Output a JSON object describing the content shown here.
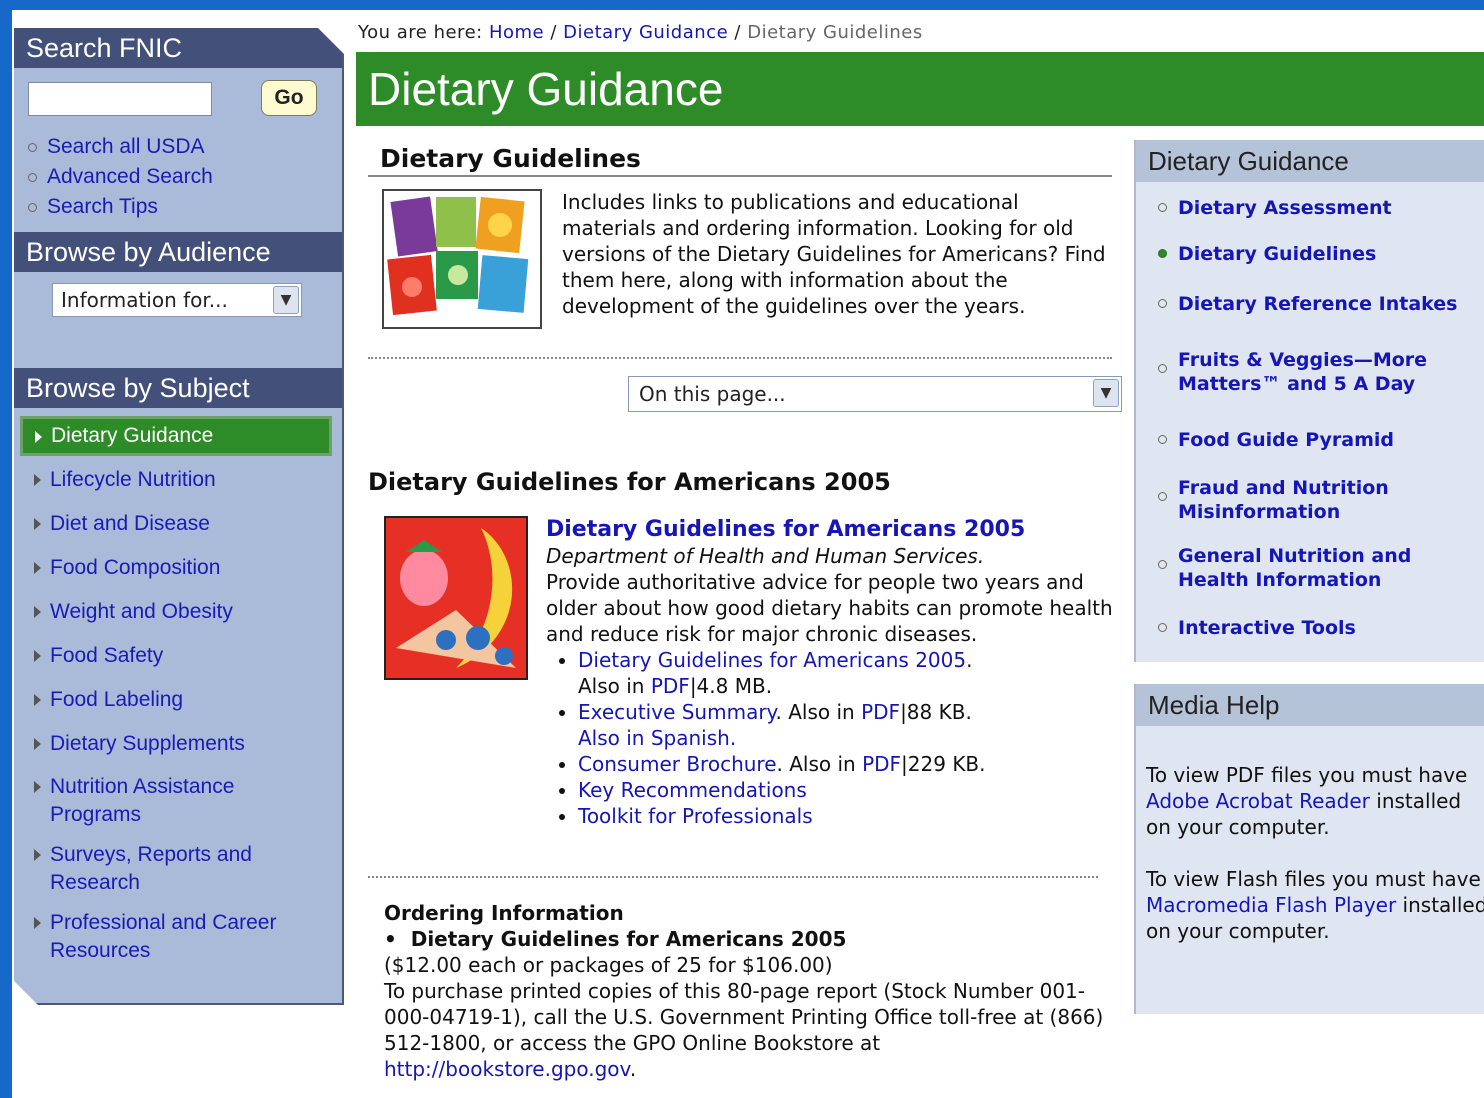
{
  "search": {
    "heading": "Search FNIC",
    "input_value": "",
    "go_label": "Go",
    "links": [
      "Search all USDA",
      "Advanced Search",
      "Search Tips"
    ]
  },
  "audience": {
    "heading": "Browse by Audience",
    "select_value": "Information for..."
  },
  "subject": {
    "heading": "Browse by Subject",
    "items": [
      {
        "label": "Dietary Guidance"
      },
      {
        "label": "Lifecycle Nutrition"
      },
      {
        "label": "Diet and Disease"
      },
      {
        "label": "Food Composition"
      },
      {
        "label": "Weight and Obesity"
      },
      {
        "label": "Food Safety"
      },
      {
        "label": "Food Labeling"
      },
      {
        "label": "Dietary Supplements"
      },
      {
        "label": "Nutrition Assistance Programs"
      },
      {
        "label": "Surveys, Reports and Research"
      },
      {
        "label": "Professional and Career Resources"
      }
    ]
  },
  "breadcrumb": {
    "prefix": "You are here:",
    "home": "Home",
    "parent": "Dietary Guidance",
    "current": "Dietary Guidelines",
    "sep": "/"
  },
  "banner": {
    "title": "Dietary Guidance"
  },
  "main": {
    "section_title": "Dietary Guidelines",
    "intro_text": "Includes links to publications and educational materials and ordering information. Looking for old versions of the Dietary Guidelines for Americans? Find them here, along with information about the development of the guidelines over the years.",
    "page_select": "On this page...",
    "h2": "Dietary Guidelines for Americans 2005",
    "dg_title": "Dietary Guidelines for Americans 2005",
    "dg_source": "Department of Health and Human Services.",
    "dg_desc": "Provide authoritative advice for people two years and older about how good dietary habits can promote health and reduce risk for major chronic diseases.",
    "bullets": {
      "b1_link": "Dietary Guidelines for Americans 2005",
      "b1_after": ".",
      "b1_also": "Also in ",
      "b1_pdf": "PDF",
      "b1_size": "|4.8 MB.",
      "b2_link": "Executive Summary",
      "b2_also": ". Also in ",
      "b2_pdf": "PDF",
      "b2_size": "|88 KB.",
      "b2_spanish": "Also in Spanish.",
      "b3_link": "Consumer Brochure",
      "b3_also": ". Also in ",
      "b3_pdf": "PDF",
      "b3_size": "|229 KB.",
      "b4_link": "Key Recommendations",
      "b5_link": "Toolkit for Professionals"
    },
    "ordering": {
      "heading": "Ordering Information",
      "item": "Dietary Guidelines for Americans 2005",
      "price": "($12.00 each or packages of 25 for $106.00)",
      "text": "To purchase printed copies of this 80-page report (Stock Number 001-000-04719-1), call the U.S. Government Printing Office toll-free at (866) 512-1800, or access the GPO Online Bookstore at ",
      "link": "http://bookstore.gpo.gov",
      "end": "."
    }
  },
  "right_nav": {
    "heading": "Dietary Guidance",
    "items": [
      "Dietary Assessment",
      "Dietary Guidelines",
      "Dietary Reference Intakes",
      "Fruits & Veggies—More Matters™ and 5 A Day",
      "Food Guide Pyramid",
      "Fraud and Nutrition Misinformation",
      "General Nutrition and Health Information",
      "Interactive Tools"
    ]
  },
  "media_help": {
    "heading": "Media Help",
    "pdf_text": "To view PDF files you must have ",
    "pdf_link": "Adobe Acrobat Reader",
    "pdf_end": " installed on your computer.",
    "flash_text": "To view Flash files you must have ",
    "flash_link": "Macromedia Flash Player",
    "flash_end": " installed on your computer."
  },
  "colors": {
    "accent_green": "#2d8c28",
    "sidebar_bg": "#a9bbd9",
    "sidebar_header": "#43517a",
    "link": "#1515b8",
    "frame_blue": "#1669c9"
  }
}
